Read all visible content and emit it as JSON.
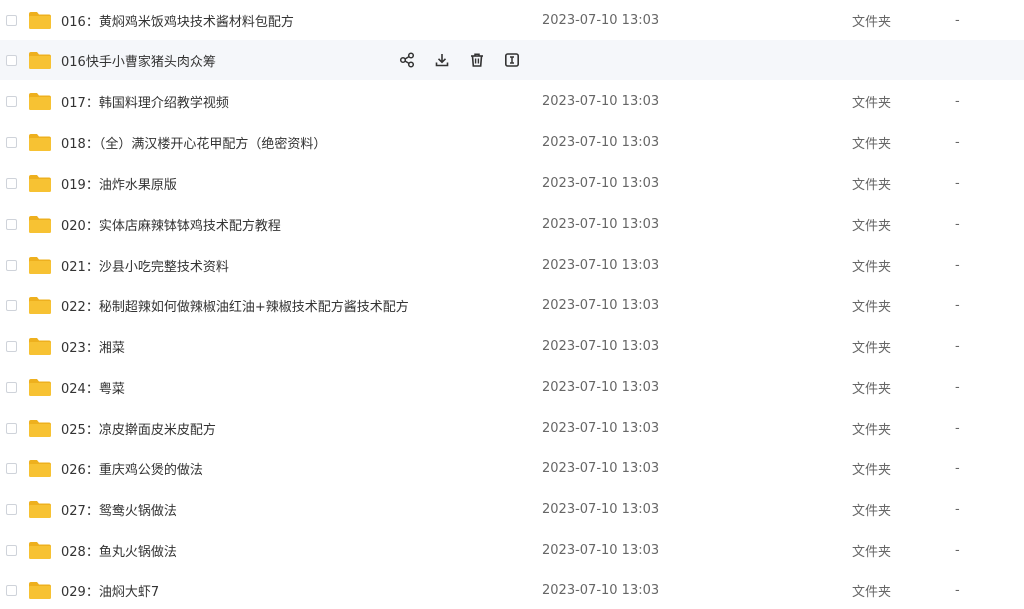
{
  "hovered_row": {
    "name": "016快手小曹家猪头肉众筹",
    "actions": [
      {
        "icon": "share-icon",
        "label": "分享"
      },
      {
        "icon": "download-icon",
        "label": "下载"
      },
      {
        "icon": "delete-icon",
        "label": "删除"
      },
      {
        "icon": "rename-icon",
        "label": "重命名"
      }
    ]
  },
  "rows": [
    {
      "name": "016：黄焖鸡米饭鸡块技术酱材料包配方",
      "time": "2023-07-10 13:03",
      "type": "文件夹",
      "size": "-"
    },
    {
      "name": "017：韩国料理介绍教学视频",
      "time": "2023-07-10 13:03",
      "type": "文件夹",
      "size": "-"
    },
    {
      "name": "018：（全）满汉楼开心花甲配方（绝密资料）",
      "time": "2023-07-10 13:03",
      "type": "文件夹",
      "size": "-"
    },
    {
      "name": "019：油炸水果原版",
      "time": "2023-07-10 13:03",
      "type": "文件夹",
      "size": "-"
    },
    {
      "name": "020：实体店麻辣钵钵鸡技术配方教程",
      "time": "2023-07-10 13:03",
      "type": "文件夹",
      "size": "-"
    },
    {
      "name": "021：沙县小吃完整技术资料",
      "time": "2023-07-10 13:03",
      "type": "文件夹",
      "size": "-"
    },
    {
      "name": "022：秘制超辣如何做辣椒油红油+辣椒技术配方酱技术配方",
      "time": "2023-07-10 13:03",
      "type": "文件夹",
      "size": "-"
    },
    {
      "name": "023：湘菜",
      "time": "2023-07-10 13:03",
      "type": "文件夹",
      "size": "-"
    },
    {
      "name": "024：粤菜",
      "time": "2023-07-10 13:03",
      "type": "文件夹",
      "size": "-"
    },
    {
      "name": "025：凉皮擀面皮米皮配方",
      "time": "2023-07-10 13:03",
      "type": "文件夹",
      "size": "-"
    },
    {
      "name": "026：重庆鸡公煲的做法",
      "time": "2023-07-10 13:03",
      "type": "文件夹",
      "size": "-"
    },
    {
      "name": "027：鸳鸯火锅做法",
      "time": "2023-07-10 13:03",
      "type": "文件夹",
      "size": "-"
    },
    {
      "name": "028：鱼丸火锅做法",
      "time": "2023-07-10 13:03",
      "type": "文件夹",
      "size": "-"
    },
    {
      "name": "029：油焖大虾7",
      "time": "2023-07-10 13:03",
      "type": "文件夹",
      "size": "-"
    }
  ],
  "colors": {
    "folder": "#f7c233",
    "folder_dark": "#eeb01e",
    "hover_bg": "#f5f7fa",
    "icon": "#333333"
  }
}
